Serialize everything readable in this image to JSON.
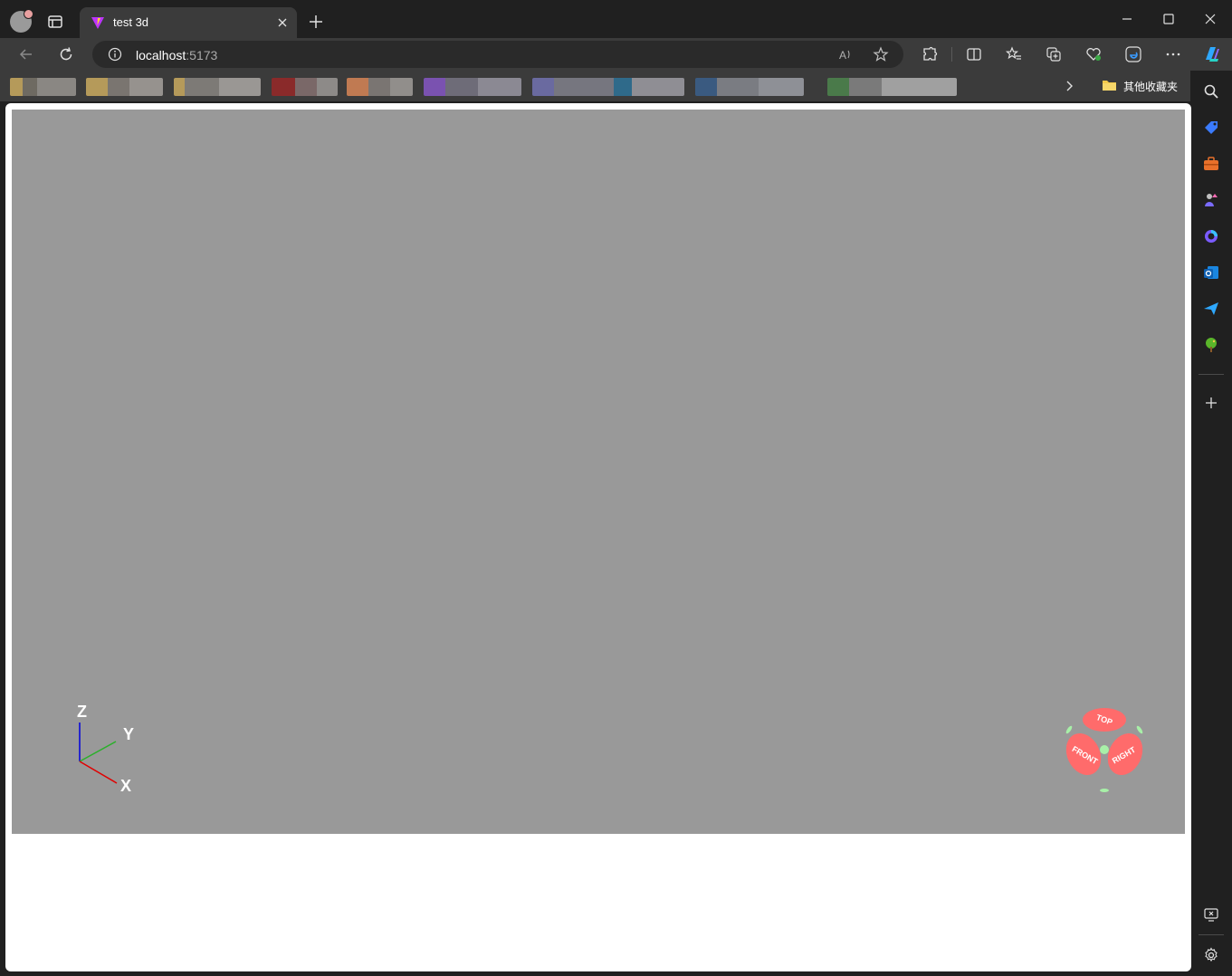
{
  "tab": {
    "title": "test 3d"
  },
  "address_bar": {
    "host": "localhost",
    "port": ":5173"
  },
  "bookmarks_bar": {
    "other_favorites_label": "其他收藏夹"
  },
  "viewport": {
    "axis_labels": {
      "x": "X",
      "y": "Y",
      "z": "Z"
    },
    "view_cube": {
      "top": "TOP",
      "front": "FRONT",
      "right": "RIGHT"
    }
  },
  "colors": {
    "viewport_bg": "#999999",
    "axis_x": "#e00000",
    "axis_y": "#2bb02b",
    "axis_z": "#0000dd",
    "cube_face": "#ff6b6b",
    "cube_edge": "#a8f0a8"
  }
}
